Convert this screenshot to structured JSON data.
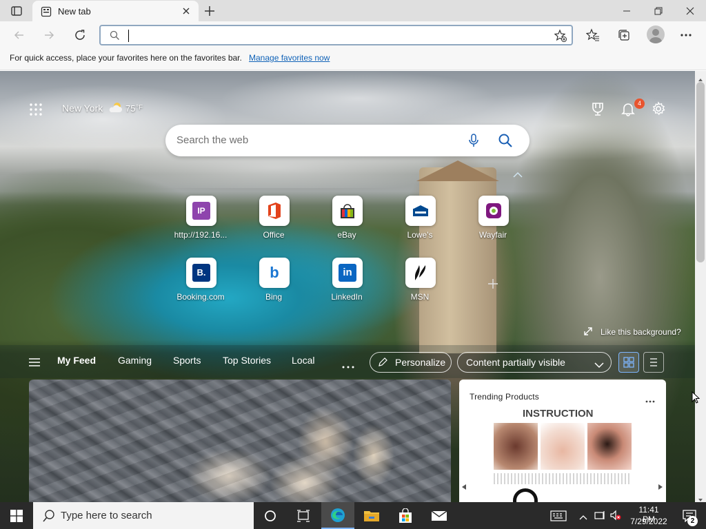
{
  "browser": {
    "tab_title": "New tab",
    "address_value": "",
    "favorites_hint": "For quick access, place your favorites here on the favorites bar.",
    "favorites_link": "Manage favorites now"
  },
  "newtab": {
    "location": "New York",
    "temperature": "75",
    "temp_unit": "°F",
    "notification_count": "4",
    "search_placeholder": "Search the web",
    "like_background": "Like this background?",
    "tiles": [
      {
        "label": "http://192.16...",
        "icon": "IP"
      },
      {
        "label": "Office",
        "icon": "office-icon"
      },
      {
        "label": "eBay",
        "icon": "ebay-icon"
      },
      {
        "label": "Lowe's",
        "icon": "lowes-icon"
      },
      {
        "label": "Wayfair",
        "icon": "wayfair-icon"
      },
      {
        "label": "Booking.com",
        "icon": "B."
      },
      {
        "label": "Bing",
        "icon": "b"
      },
      {
        "label": "LinkedIn",
        "icon": "in"
      },
      {
        "label": "MSN",
        "icon": "msn-icon"
      }
    ],
    "feed_tabs": [
      "My Feed",
      "Gaming",
      "Sports",
      "Top Stories",
      "Local"
    ],
    "personalize": "Personalize",
    "content_visibility": "Content partially visible",
    "trending_title": "Trending Products",
    "trending_image_text": "INSTRUCTION"
  },
  "taskbar": {
    "search_placeholder": "Type here to search",
    "time": "11:41 PM",
    "date": "7/29/2022",
    "notification_count": "2"
  },
  "colors": {
    "accent": "#0e61b7",
    "taskbar": "#2a2a2a",
    "badge": "#e8542f"
  }
}
